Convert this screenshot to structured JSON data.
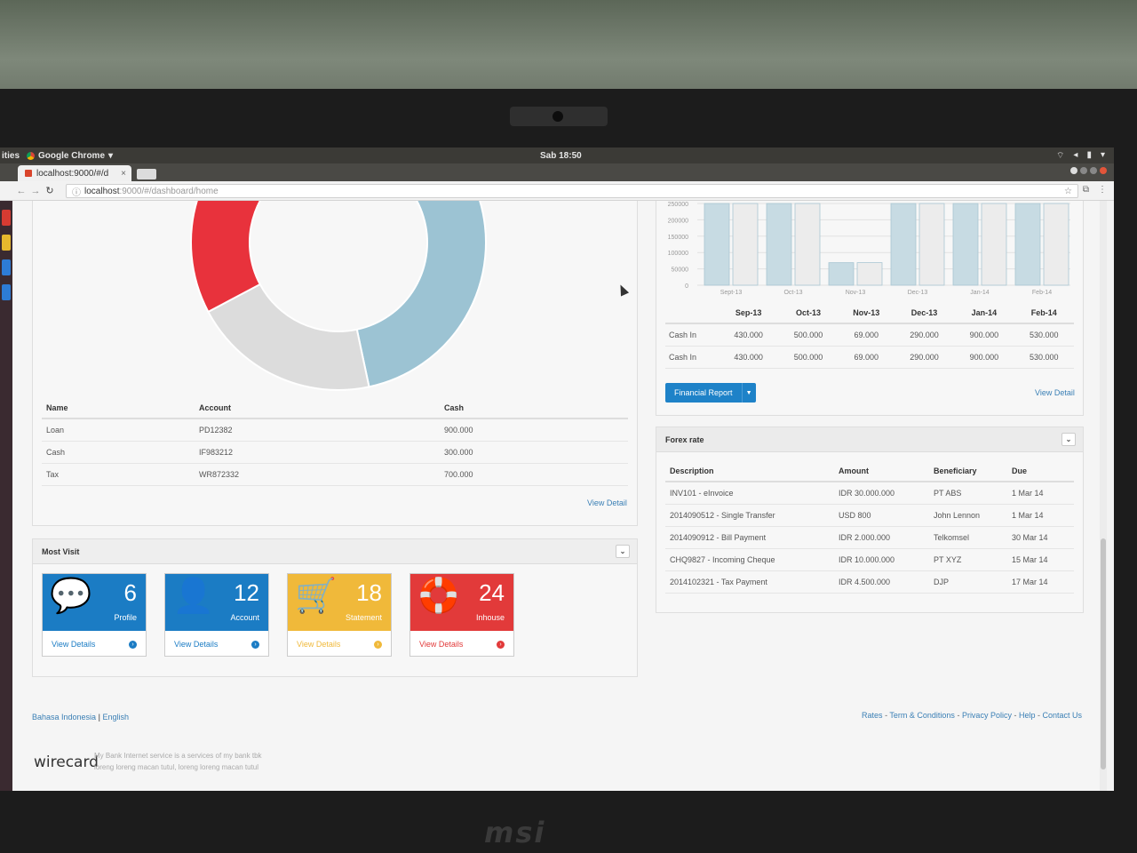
{
  "system": {
    "apps_label": "ities",
    "active_app": "Google Chrome",
    "clock": "Sab 18:50"
  },
  "browser": {
    "tab_title": "localhost:9000/#/d",
    "url_host": "localhost",
    "url_path": ":9000/#/dashboard/home"
  },
  "accounts": {
    "headers": [
      "Name",
      "Account",
      "Cash"
    ],
    "rows": [
      {
        "name": "Loan",
        "account": "PD12382",
        "cash": "900.000"
      },
      {
        "name": "Cash",
        "account": "IF983212",
        "cash": "300.000"
      },
      {
        "name": "Tax",
        "account": "WR872332",
        "cash": "700.000"
      }
    ],
    "view_detail": "View Detail"
  },
  "donut": {
    "colors": {
      "red": "#e8323c",
      "gray": "#dcdcdc",
      "blue": "#9cc3d3"
    }
  },
  "chart_data": {
    "type": "bar",
    "categories": [
      "Sept-13",
      "Oct-13",
      "Nov-13",
      "Dec-13",
      "Jan-14",
      "Feb-14"
    ],
    "series": [
      {
        "values": [
          430000,
          500000,
          69000,
          290000,
          900000,
          530000
        ]
      },
      {
        "values": [
          430000,
          500000,
          69000,
          290000,
          900000,
          530000
        ]
      }
    ],
    "yticks": [
      0,
      50000,
      100000,
      150000,
      200000,
      250000
    ],
    "ylim": [
      0,
      250000
    ],
    "colors": [
      "#c7dbe3",
      "#ececec"
    ]
  },
  "cashflow": {
    "headers": [
      "",
      "Sep-13",
      "Oct-13",
      "Nov-13",
      "Dec-13",
      "Jan-14",
      "Feb-14"
    ],
    "rows": [
      [
        "Cash In",
        "430.000",
        "500.000",
        "69.000",
        "290.000",
        "900.000",
        "530.000"
      ],
      [
        "Cash In",
        "430.000",
        "500.000",
        "69.000",
        "290.000",
        "900.000",
        "530.000"
      ]
    ],
    "report_button": "Financial Report",
    "view_detail": "View Detail"
  },
  "forex": {
    "title": "Forex rate",
    "headers": [
      "Description",
      "Amount",
      "Beneficiary",
      "Due"
    ],
    "rows": [
      [
        "INV101 - eInvoice",
        "IDR 30.000.000",
        "PT ABS",
        "1 Mar 14"
      ],
      [
        "2014090512 - Single Transfer",
        "USD 800",
        "John Lennon",
        "1 Mar 14"
      ],
      [
        "2014090912 - Bill Payment",
        "IDR 2.000.000",
        "Telkomsel",
        "30 Mar 14"
      ],
      [
        "CHQ9827 - Incoming Cheque",
        "IDR 10.000.000",
        "PT XYZ",
        "15 Mar 14"
      ],
      [
        "2014102321 - Tax Payment",
        "IDR 4.500.000",
        "DJP",
        "17 Mar 14"
      ]
    ]
  },
  "most_visit": {
    "title": "Most Visit",
    "tiles": [
      {
        "count": "6",
        "label": "Profile",
        "link": "View Details",
        "color": "#1b7cc4",
        "icon": "chat-icon"
      },
      {
        "count": "12",
        "label": "Account",
        "link": "View Details",
        "color": "#1b7cc4",
        "icon": "user-icon"
      },
      {
        "count": "18",
        "label": "Statement",
        "link": "View Details",
        "color": "#f0b93a",
        "icon": "cart-icon"
      },
      {
        "count": "24",
        "label": "Inhouse",
        "link": "View Details",
        "color": "#e23a3a",
        "icon": "lifebuoy-icon"
      }
    ]
  },
  "footer": {
    "lang_id": "Bahasa Indonesia",
    "lang_sep": "|",
    "lang_en": "English",
    "links": [
      "Rates",
      "Term & Conditions",
      "Privacy Policy",
      "Help",
      "Contact Us"
    ],
    "link_sep": " - ",
    "logo": "wirecard",
    "note_line1": "My Bank Internet service is a services of my bank tbk",
    "note_line2": "loreng loreng macan tutul, loreng loreng macan tutul"
  }
}
